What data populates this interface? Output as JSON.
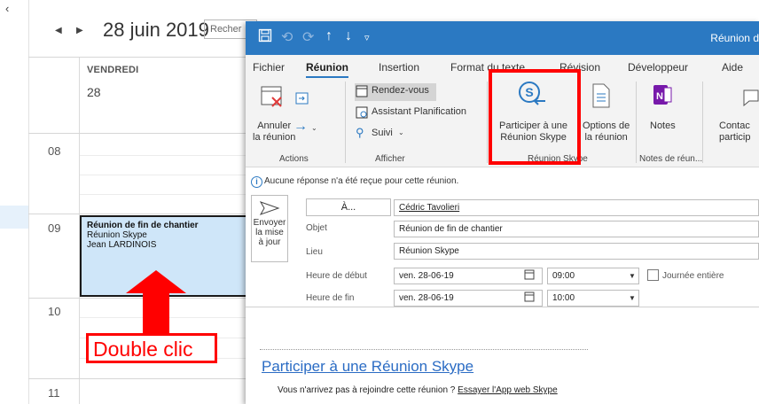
{
  "calendar": {
    "collapse": "‹",
    "prev": "◀",
    "next": "▶",
    "date_title": "28 juin 2019",
    "search_placeholder": "Recher",
    "day_header": "VENDREDI",
    "day_number": "28",
    "hours": [
      "08",
      "09",
      "10",
      "11"
    ],
    "event": {
      "title": "Réunion de fin de chantier",
      "location": "Réunion Skype",
      "organizer": "Jean LARDINOIS"
    }
  },
  "annotation": {
    "double_click_label": "Double clic",
    "color": "#ff0000"
  },
  "window": {
    "title": "Réunion d",
    "quick_access": [
      "save-icon",
      "undo-icon",
      "redo-icon",
      "up-icon",
      "down-icon",
      "customize-icon"
    ],
    "accent": "#2b79c2"
  },
  "menu": {
    "tabs": [
      "Fichier",
      "Réunion",
      "Insertion",
      "Format du texte",
      "Révision",
      "Développeur",
      "Aide"
    ],
    "active": "Réunion"
  },
  "ribbon": {
    "actions": {
      "cancel_line1": "Annuler",
      "cancel_line2": "la réunion",
      "group": "Actions"
    },
    "afficher": {
      "rendezvous": "Rendez-vous",
      "assistant": "Assistant Planification",
      "suivi": "Suivi",
      "group": "Afficher"
    },
    "skype": {
      "join_line1": "Participer à une",
      "join_line2": "Réunion Skype",
      "options_line1": "Options de",
      "options_line2": "la réunion",
      "group": "Réunion Skype"
    },
    "notes": {
      "label": "Notes",
      "group": "Notes de réun..."
    },
    "contacts": {
      "line1": "Contac",
      "line2": "particip"
    }
  },
  "info_bar": "Aucune réponse n'a été reçue pour cette réunion.",
  "form": {
    "send_line1": "Envoyer",
    "send_line2": "la mise",
    "send_line3": "à jour",
    "to_button": "À...",
    "to_value": "Cédric Tavolieri",
    "subject_label": "Objet",
    "subject_value": "Réunion de fin de chantier",
    "location_label": "Lieu",
    "location_value": "Réunion Skype",
    "start_label": "Heure de début",
    "start_date": "ven. 28-06-19",
    "start_time": "09:00",
    "all_day_label": "Journée entière",
    "end_label": "Heure de fin",
    "end_date": "ven. 28-06-19",
    "end_time": "10:00"
  },
  "body": {
    "join_link": "Participer à une Réunion Skype",
    "cant_join_prefix": "Vous n'arrivez pas à rejoindre cette réunion ?",
    "web_app_link": "Essayer l'App web Skype"
  }
}
